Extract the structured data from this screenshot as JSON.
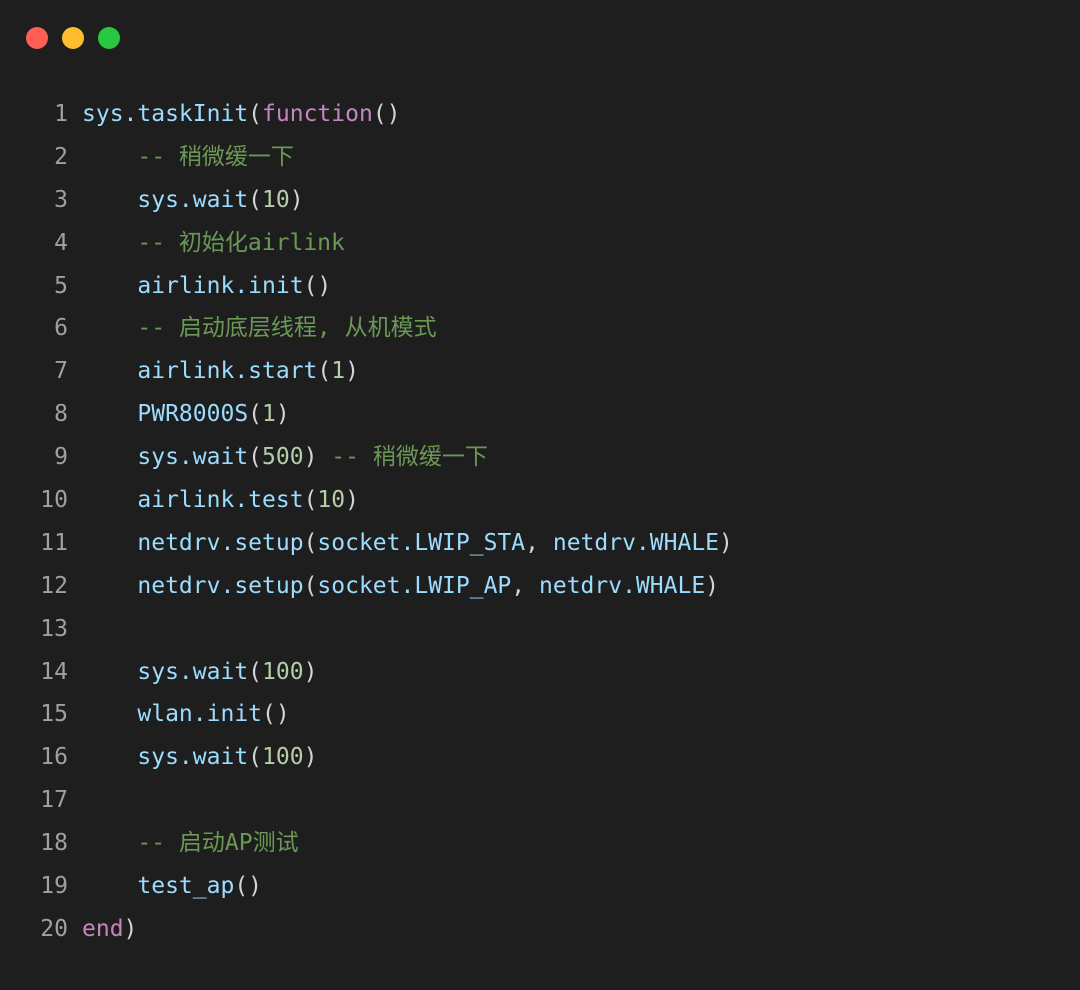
{
  "window": {
    "traffic_lights": [
      {
        "name": "close",
        "color": "#ff5f57"
      },
      {
        "name": "minimize",
        "color": "#febc2e"
      },
      {
        "name": "zoom",
        "color": "#28c840"
      }
    ]
  },
  "colors": {
    "background": "#1e1e1e",
    "identifier": "#9cdcfe",
    "keyword": "#c586c0",
    "punctuation": "#d4d4d4",
    "number": "#b5cea8",
    "comment": "#6a9955",
    "line_number": "#a0a0a0"
  },
  "code": {
    "lines": [
      {
        "number": "1",
        "tokens": [
          [
            "ident",
            "sys.taskInit"
          ],
          [
            "punc",
            "("
          ],
          [
            "kw",
            "function"
          ],
          [
            "punc",
            "()"
          ]
        ]
      },
      {
        "number": "2",
        "tokens": [
          [
            "ident",
            "    "
          ],
          [
            "comment",
            "-- 稍微缓一下"
          ]
        ]
      },
      {
        "number": "3",
        "tokens": [
          [
            "ident",
            "    sys.wait"
          ],
          [
            "punc",
            "("
          ],
          [
            "num",
            "10"
          ],
          [
            "punc",
            ")"
          ]
        ]
      },
      {
        "number": "4",
        "tokens": [
          [
            "ident",
            "    "
          ],
          [
            "comment",
            "-- 初始化airlink"
          ]
        ]
      },
      {
        "number": "5",
        "tokens": [
          [
            "ident",
            "    airlink.init"
          ],
          [
            "punc",
            "()"
          ]
        ]
      },
      {
        "number": "6",
        "tokens": [
          [
            "ident",
            "    "
          ],
          [
            "comment",
            "-- 启动底层线程, 从机模式"
          ]
        ]
      },
      {
        "number": "7",
        "tokens": [
          [
            "ident",
            "    airlink.start"
          ],
          [
            "punc",
            "("
          ],
          [
            "num",
            "1"
          ],
          [
            "punc",
            ")"
          ]
        ]
      },
      {
        "number": "8",
        "tokens": [
          [
            "ident",
            "    PWR8000S"
          ],
          [
            "punc",
            "("
          ],
          [
            "num",
            "1"
          ],
          [
            "punc",
            ")"
          ]
        ]
      },
      {
        "number": "9",
        "tokens": [
          [
            "ident",
            "    sys.wait"
          ],
          [
            "punc",
            "("
          ],
          [
            "num",
            "500"
          ],
          [
            "punc",
            ") "
          ],
          [
            "comment",
            "-- 稍微缓一下"
          ]
        ]
      },
      {
        "number": "10",
        "tokens": [
          [
            "ident",
            "    airlink.test"
          ],
          [
            "punc",
            "("
          ],
          [
            "num",
            "10"
          ],
          [
            "punc",
            ")"
          ]
        ]
      },
      {
        "number": "11",
        "tokens": [
          [
            "ident",
            "    netdrv.setup"
          ],
          [
            "punc",
            "("
          ],
          [
            "ident",
            "socket.LWIP_STA"
          ],
          [
            "punc",
            ", "
          ],
          [
            "ident",
            "netdrv.WHALE"
          ],
          [
            "punc",
            ")"
          ]
        ]
      },
      {
        "number": "12",
        "tokens": [
          [
            "ident",
            "    netdrv.setup"
          ],
          [
            "punc",
            "("
          ],
          [
            "ident",
            "socket.LWIP_AP"
          ],
          [
            "punc",
            ", "
          ],
          [
            "ident",
            "netdrv.WHALE"
          ],
          [
            "punc",
            ")"
          ]
        ]
      },
      {
        "number": "13",
        "tokens": []
      },
      {
        "number": "14",
        "tokens": [
          [
            "ident",
            "    sys.wait"
          ],
          [
            "punc",
            "("
          ],
          [
            "num",
            "100"
          ],
          [
            "punc",
            ")"
          ]
        ]
      },
      {
        "number": "15",
        "tokens": [
          [
            "ident",
            "    wlan.init"
          ],
          [
            "punc",
            "()"
          ]
        ]
      },
      {
        "number": "16",
        "tokens": [
          [
            "ident",
            "    sys.wait"
          ],
          [
            "punc",
            "("
          ],
          [
            "num",
            "100"
          ],
          [
            "punc",
            ")"
          ]
        ]
      },
      {
        "number": "17",
        "tokens": []
      },
      {
        "number": "18",
        "tokens": [
          [
            "ident",
            "    "
          ],
          [
            "comment",
            "-- 启动AP测试"
          ]
        ]
      },
      {
        "number": "19",
        "tokens": [
          [
            "ident",
            "    test_ap"
          ],
          [
            "punc",
            "()"
          ]
        ]
      },
      {
        "number": "20",
        "tokens": [
          [
            "kw",
            "end"
          ],
          [
            "punc",
            ")"
          ]
        ]
      }
    ]
  }
}
